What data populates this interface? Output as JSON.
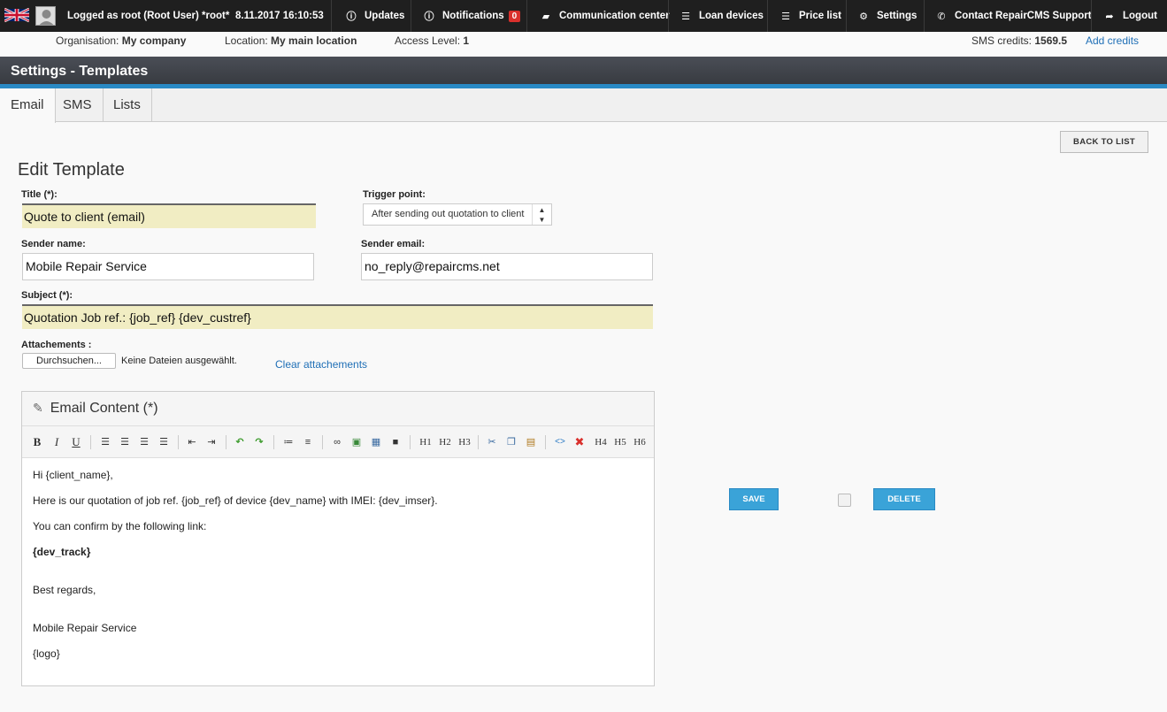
{
  "topbar": {
    "logged_as": "Logged as root (Root User) *root*",
    "datetime": "8.11.2017 16:10:53",
    "updates": "Updates",
    "notifications": "Notifications",
    "notifications_count": "0",
    "communication": "Communication center",
    "loan_devices": "Loan devices",
    "price_list": "Price list",
    "settings": "Settings",
    "support": "Contact RepairCMS Support",
    "logout": "Logout"
  },
  "infobar": {
    "org_label": "Organisation:",
    "org_value": "My company",
    "loc_label": "Location:",
    "loc_value": "My main location",
    "access_label": "Access Level:",
    "access_value": "1",
    "sms_label": "SMS credits:",
    "sms_value": "1569.5",
    "add_credits": "Add credits"
  },
  "section_title": "Settings - Templates",
  "tabs": [
    {
      "label": "Email",
      "active": true
    },
    {
      "label": "SMS",
      "active": false
    },
    {
      "label": "Lists",
      "active": false
    }
  ],
  "back_to_list": "BACK TO LIST",
  "form": {
    "heading": "Edit Template",
    "title_label": "Title (*):",
    "title_value": "Quote to client (email)",
    "trigger_label": "Trigger point:",
    "trigger_value": "After sending out quotation to client",
    "sender_name_label": "Sender name:",
    "sender_name_value": "Mobile Repair Service",
    "sender_email_label": "Sender email:",
    "sender_email_value": "no_reply@repaircms.net",
    "subject_label": "Subject (*):",
    "subject_value": "Quotation Job ref.: {job_ref}  {dev_custref}",
    "attachments_label": "Attachements :",
    "browse_button": "Durchsuchen...",
    "no_files": "Keine Dateien ausgewählt.",
    "clear_attachments": "Clear attachements"
  },
  "editor": {
    "heading": "Email Content (*)",
    "toolbar": {
      "h1": "H1",
      "h2": "H2",
      "h3": "H3",
      "h4": "H4",
      "h5": "H5",
      "h6": "H6"
    },
    "lines": [
      "Hi {client_name},",
      "Here is our quotation of job ref. {job_ref} of device {dev_name} with IMEI: {dev_imser}.",
      "You can confirm by the following link:",
      "{dev_track}",
      "Best regards,",
      "Mobile Repair Service",
      "{logo}"
    ]
  },
  "actions": {
    "save": "SAVE",
    "delete": "DELETE"
  },
  "colors": {
    "accent": "#2a8ac4",
    "button_blue": "#3aa3d8",
    "required_field": "#f1edc3",
    "topbar": "#1f1f1f",
    "badge": "#d9302c"
  }
}
